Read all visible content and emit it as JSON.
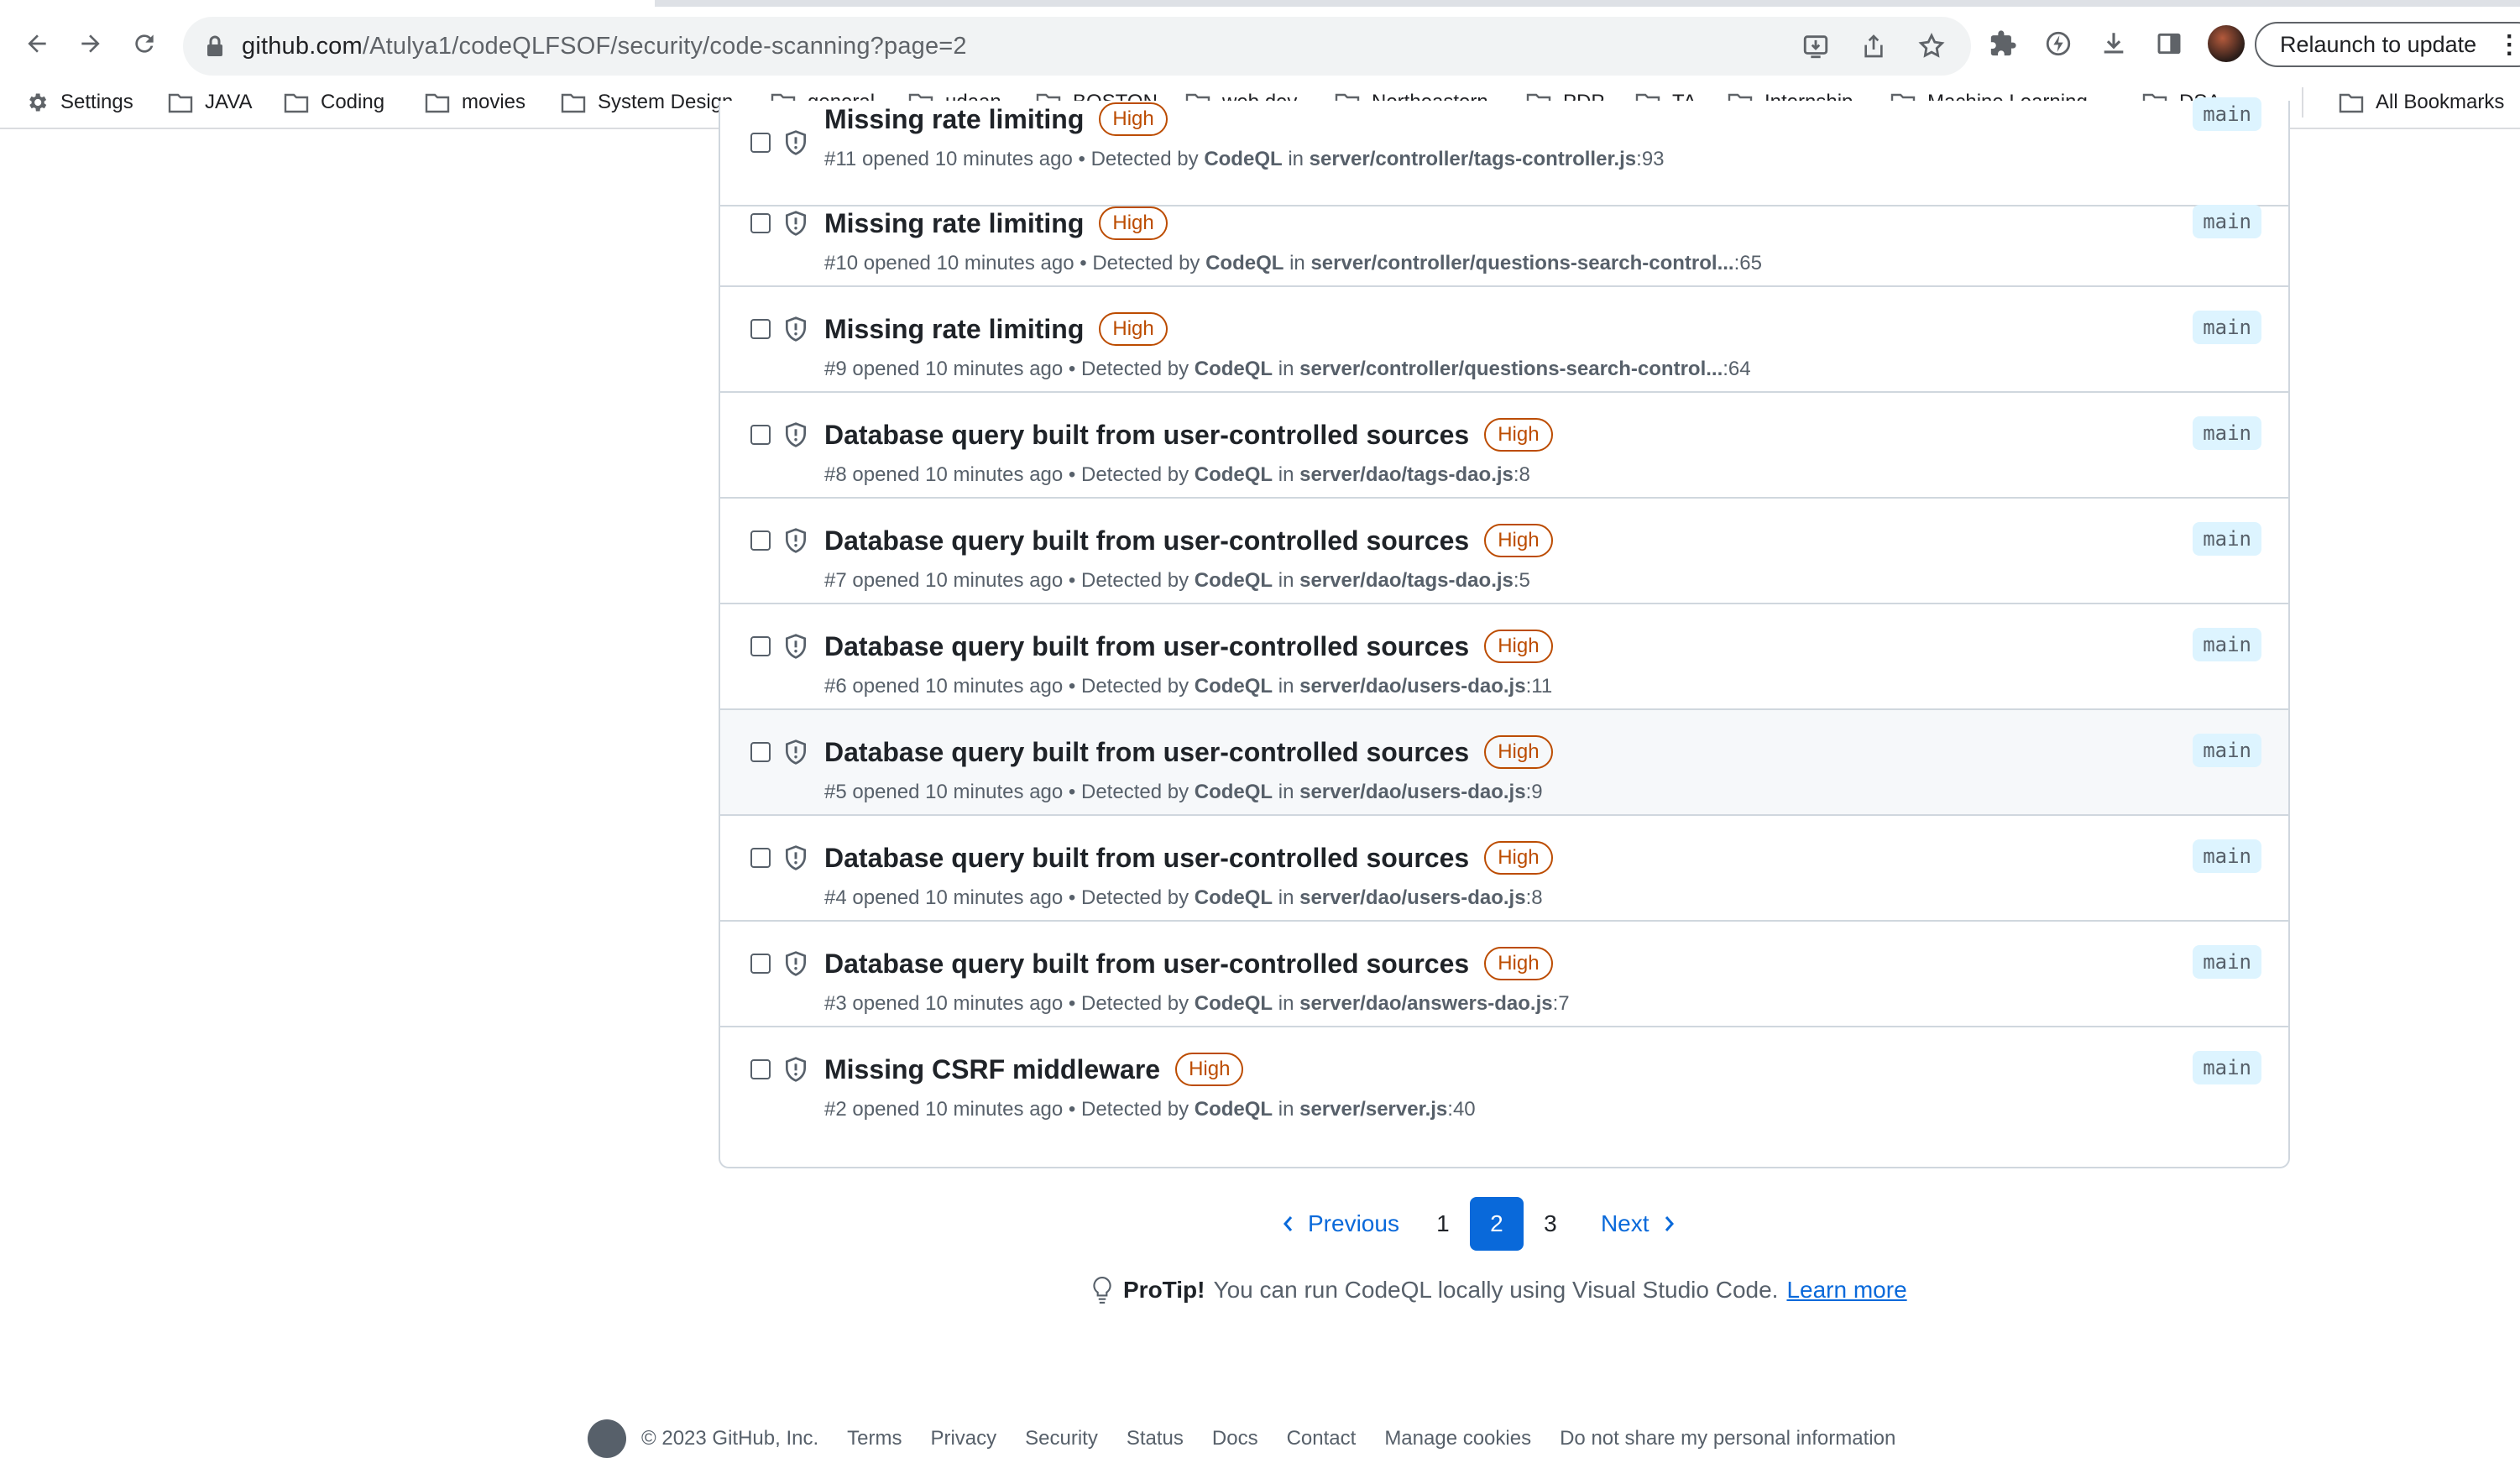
{
  "browser": {
    "url_host": "github.com",
    "url_path": "/Atulya1/codeQLFSOF/security/code-scanning?page=2",
    "relaunch_label": "Relaunch to update",
    "bookmarks": [
      "Settings",
      "JAVA",
      "Coding",
      "movies",
      "System Design",
      "general",
      "udaan",
      "BOSTON",
      "web dev",
      "Northeastern",
      "PDP",
      "TA",
      "Internship",
      "Machine Learning...",
      "DSA"
    ],
    "all_bookmarks": "All Bookmarks"
  },
  "alerts": [
    {
      "title": "Missing rate limiting",
      "severity": "High",
      "number": "#11",
      "opened": "opened 10 minutes ago",
      "detected": "Detected by",
      "tool": "CodeQL",
      "in": "in",
      "path": "server/controller/tags-controller.js",
      "line": ":93",
      "branch": "main"
    },
    {
      "title": "Missing rate limiting",
      "severity": "High",
      "number": "#10",
      "opened": "opened 10 minutes ago",
      "detected": "Detected by",
      "tool": "CodeQL",
      "in": "in",
      "path": "server/controller/questions-search-control...",
      "line": ":65",
      "branch": "main"
    },
    {
      "title": "Missing rate limiting",
      "severity": "High",
      "number": "#9",
      "opened": "opened 10 minutes ago",
      "detected": "Detected by",
      "tool": "CodeQL",
      "in": "in",
      "path": "server/controller/questions-search-control...",
      "line": ":64",
      "branch": "main"
    },
    {
      "title": "Database query built from user-controlled sources",
      "severity": "High",
      "number": "#8",
      "opened": "opened 10 minutes ago",
      "detected": "Detected by",
      "tool": "CodeQL",
      "in": "in",
      "path": "server/dao/tags-dao.js",
      "line": ":8",
      "branch": "main"
    },
    {
      "title": "Database query built from user-controlled sources",
      "severity": "High",
      "number": "#7",
      "opened": "opened 10 minutes ago",
      "detected": "Detected by",
      "tool": "CodeQL",
      "in": "in",
      "path": "server/dao/tags-dao.js",
      "line": ":5",
      "branch": "main"
    },
    {
      "title": "Database query built from user-controlled sources",
      "severity": "High",
      "number": "#6",
      "opened": "opened 10 minutes ago",
      "detected": "Detected by",
      "tool": "CodeQL",
      "in": "in",
      "path": "server/dao/users-dao.js",
      "line": ":11",
      "branch": "main"
    },
    {
      "title": "Database query built from user-controlled sources",
      "severity": "High",
      "number": "#5",
      "opened": "opened 10 minutes ago",
      "detected": "Detected by",
      "tool": "CodeQL",
      "in": "in",
      "path": "server/dao/users-dao.js",
      "line": ":9",
      "branch": "main"
    },
    {
      "title": "Database query built from user-controlled sources",
      "severity": "High",
      "number": "#4",
      "opened": "opened 10 minutes ago",
      "detected": "Detected by",
      "tool": "CodeQL",
      "in": "in",
      "path": "server/dao/users-dao.js",
      "line": ":8",
      "branch": "main"
    },
    {
      "title": "Database query built from user-controlled sources",
      "severity": "High",
      "number": "#3",
      "opened": "opened 10 minutes ago",
      "detected": "Detected by",
      "tool": "CodeQL",
      "in": "in",
      "path": "server/dao/answers-dao.js",
      "line": ":7",
      "branch": "main"
    },
    {
      "title": "Missing CSRF middleware",
      "severity": "High",
      "number": "#2",
      "opened": "opened 10 minutes ago",
      "detected": "Detected by",
      "tool": "CodeQL",
      "in": "in",
      "path": "server/server.js",
      "line": ":40",
      "branch": "main"
    }
  ],
  "pagination": {
    "previous": "Previous",
    "pages": [
      "1",
      "2",
      "3"
    ],
    "current": "2",
    "next": "Next"
  },
  "protip": {
    "label": "ProTip!",
    "text": "You can run CodeQL locally using Visual Studio Code.",
    "link": "Learn more"
  },
  "footer": {
    "copyright": "© 2023 GitHub, Inc.",
    "links": [
      "Terms",
      "Privacy",
      "Security",
      "Status",
      "Docs",
      "Contact",
      "Manage cookies",
      "Do not share my personal information"
    ]
  }
}
